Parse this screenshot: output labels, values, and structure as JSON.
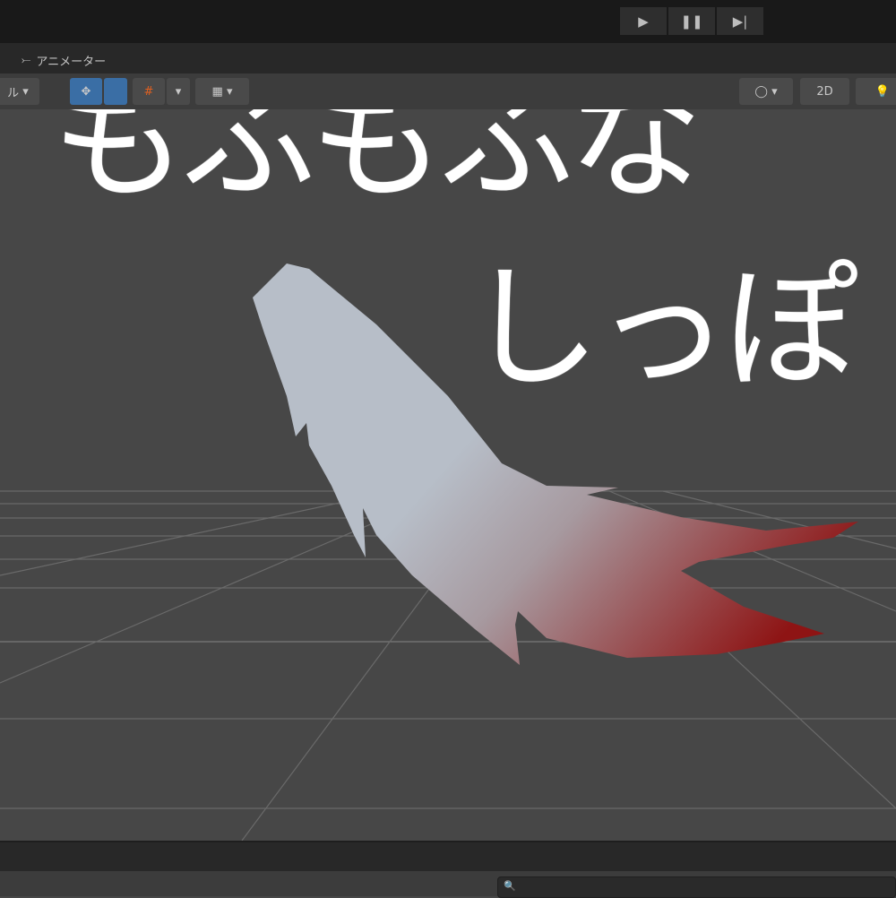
{
  "playbar": {
    "play": "▶",
    "pause": "❚❚",
    "step": "▶|"
  },
  "tab": {
    "icon": "animator-icon",
    "label": "アニメーター"
  },
  "toolbar": {
    "left_dropdown": "ル",
    "two_d": "2D"
  },
  "search": {
    "icon": "search-icon",
    "glyph": "🔍"
  },
  "handwriting": {
    "line1": "もふもふな",
    "line2": "しっぽ"
  },
  "colors": {
    "tail_top": "#b7bec8",
    "tail_tip": "#8e1414",
    "accent": "#3a6ea5"
  }
}
